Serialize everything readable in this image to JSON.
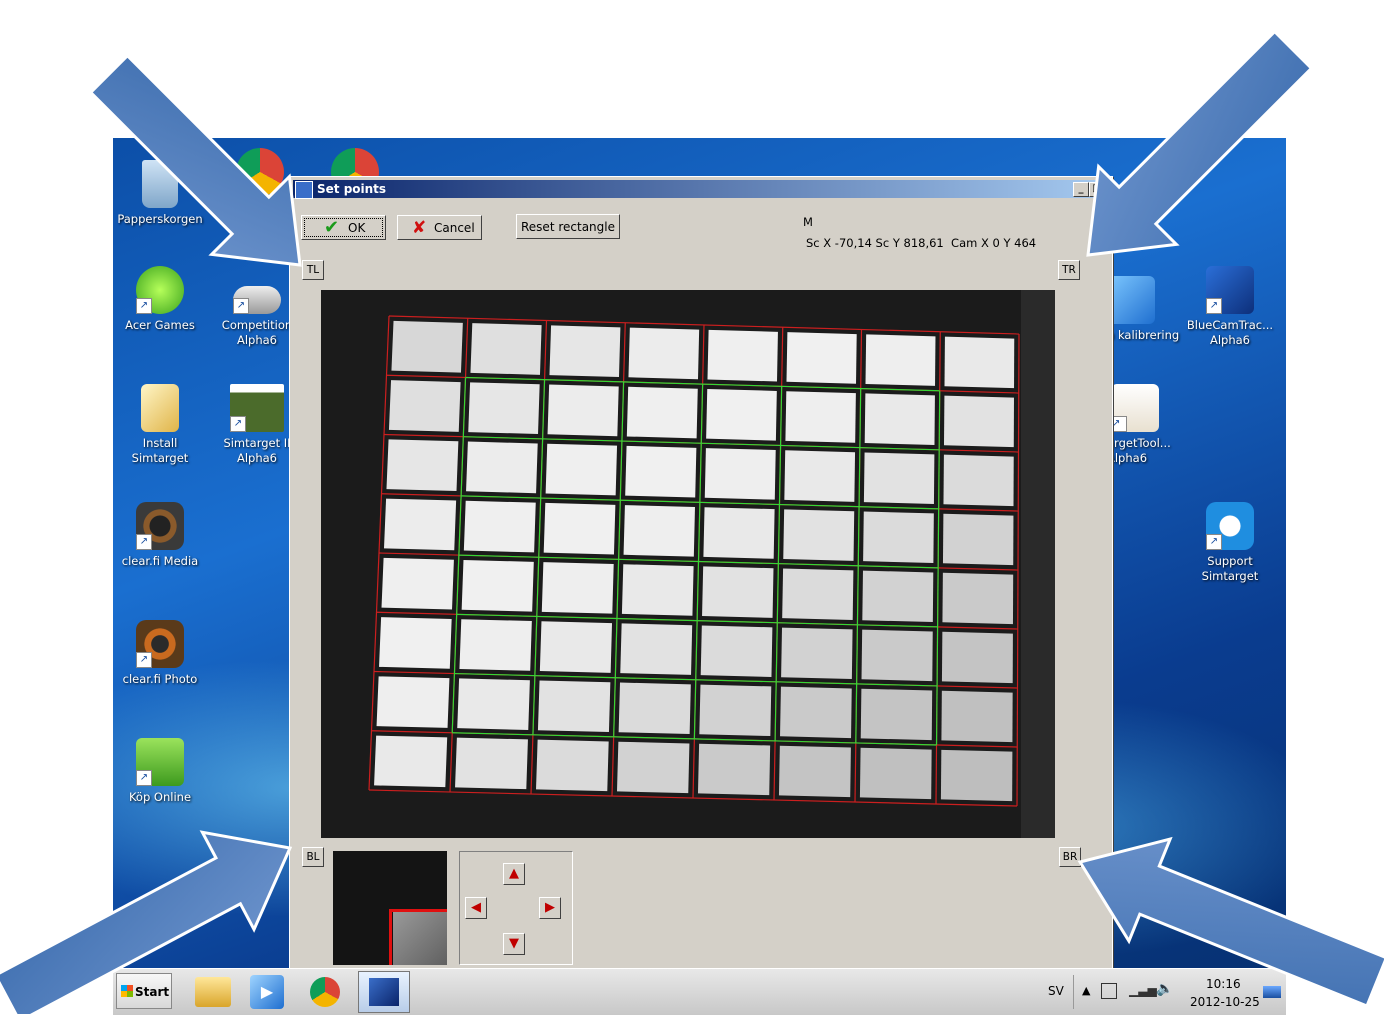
{
  "desktop": {
    "icons_left": [
      {
        "label": "Papperskorgen",
        "icon": "recycle-bin-icon"
      },
      {
        "label": "Acer Games",
        "icon": "acer-games-icon"
      },
      {
        "label": "Competition Alpha6",
        "icon": "competition-icon"
      },
      {
        "label": "Install Simtarget",
        "icon": "install-icon"
      },
      {
        "label": "Simtarget II Alpha6",
        "icon": "simtarget-icon"
      },
      {
        "label": "clear.fi Media",
        "icon": "speaker-icon"
      },
      {
        "label": "clear.fi Photo",
        "icon": "photo-icon"
      },
      {
        "label": "Köp Online",
        "icon": "acer-shop-icon"
      }
    ],
    "icons_right": [
      {
        "label": "n kalibrering",
        "icon": "calibration-icon"
      },
      {
        "label": "BlueCamTrac... Alpha6",
        "icon": "bluecam-icon"
      },
      {
        "label": "argetTool... Alpha6",
        "icon": "targettool-icon"
      },
      {
        "label": "Support Simtarget",
        "icon": "teamviewer-icon"
      }
    ]
  },
  "dialog": {
    "title": "Set points",
    "ok_label": "OK",
    "cancel_label": "Cancel",
    "reset_label": "Reset rectangle",
    "mode": "M",
    "coords": "Sc X -70,14 Sc Y 818,61  Cam X 0 Y 464",
    "corners": {
      "tl": "TL",
      "tr": "TR",
      "bl": "BL",
      "br": "BR"
    },
    "grid": {
      "cols": 8,
      "rows": 8,
      "inner_cols": 6,
      "inner_rows": 6
    },
    "colors": {
      "outer_grid": "#cc1f1f",
      "inner_grid": "#35d635",
      "titlebar": "#0a246a"
    }
  },
  "taskbar": {
    "start_label": "Start",
    "lang": "SV",
    "time": "10:16",
    "date": "2012-10-25",
    "apps": [
      "explorer-icon",
      "media-player-icon",
      "chrome-icon",
      "simtarget-app-icon"
    ]
  }
}
